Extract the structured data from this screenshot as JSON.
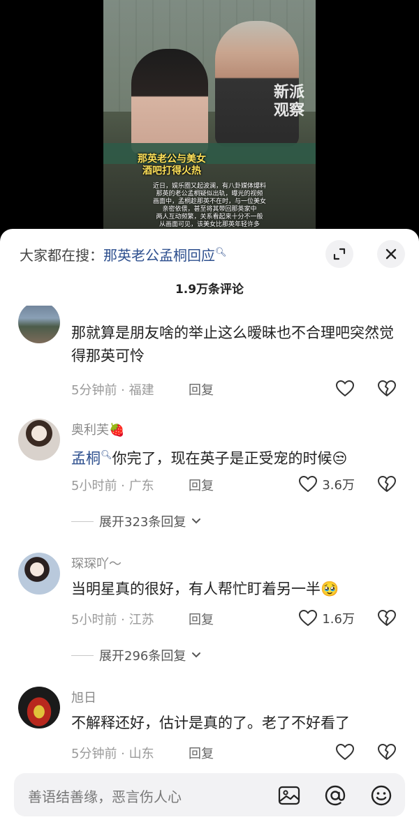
{
  "video": {
    "watermark": "新派\n观察",
    "title": "那英老公与美女\n酒吧打得火热",
    "caption": "近日，娱乐圈又起波澜，有八卦媒体爆料\n那英的老公孟桐疑似出轨，曝光的视频\n画面中，孟桐趁那英不在时，与一位美女\n亲密依偎，甚至将其带回那英家中\n两人互动频繁，关系看起来十分不一般\n从画面可见，该美女比那英年轻许多"
  },
  "header": {
    "search_prefix": "大家都在搜：",
    "search_term": "那英老公孟桐回应",
    "comment_count": "1.9万条评论"
  },
  "comments": [
    {
      "username": "",
      "text": "那就算是朋友啥的举止这么暧昧也不合理吧突然觉得那英可怜",
      "time": "5分钟前 · 福建",
      "reply": "回复",
      "likes": "",
      "expand": ""
    },
    {
      "username": "奥利芙🍓",
      "mention": "孟桐",
      "text": "你完了，现在英子是正受宠的时候",
      "emoji": "😒",
      "time": "5小时前 · 广东",
      "reply": "回复",
      "likes": "3.6万",
      "expand": "展开323条回复"
    },
    {
      "username": "琛琛吖～",
      "text": "当明星真的很好，有人帮忙盯着另一半",
      "emoji": "🥹",
      "time": "5小时前 · 江苏",
      "reply": "回复",
      "likes": "1.6万",
      "expand": "展开296条回复"
    },
    {
      "username": "旭日",
      "text": "不解释还好，估计是真的了。老了不好看了",
      "time": "5分钟前 · 山东",
      "reply": "回复",
      "likes": "",
      "expand": ""
    }
  ],
  "composer": {
    "placeholder": "善语结善缘，恶言伤人心"
  },
  "icons": {
    "expand": "expand-icon",
    "close": "close-icon",
    "like": "heart-outline-icon",
    "dislike": "broken-heart-icon",
    "image": "image-icon",
    "mention": "at-icon",
    "emoji": "emoji-icon"
  },
  "colors": {
    "link": "#2d4f8e",
    "meta": "#9a9a9a",
    "caption_title": "#ffe25a"
  }
}
